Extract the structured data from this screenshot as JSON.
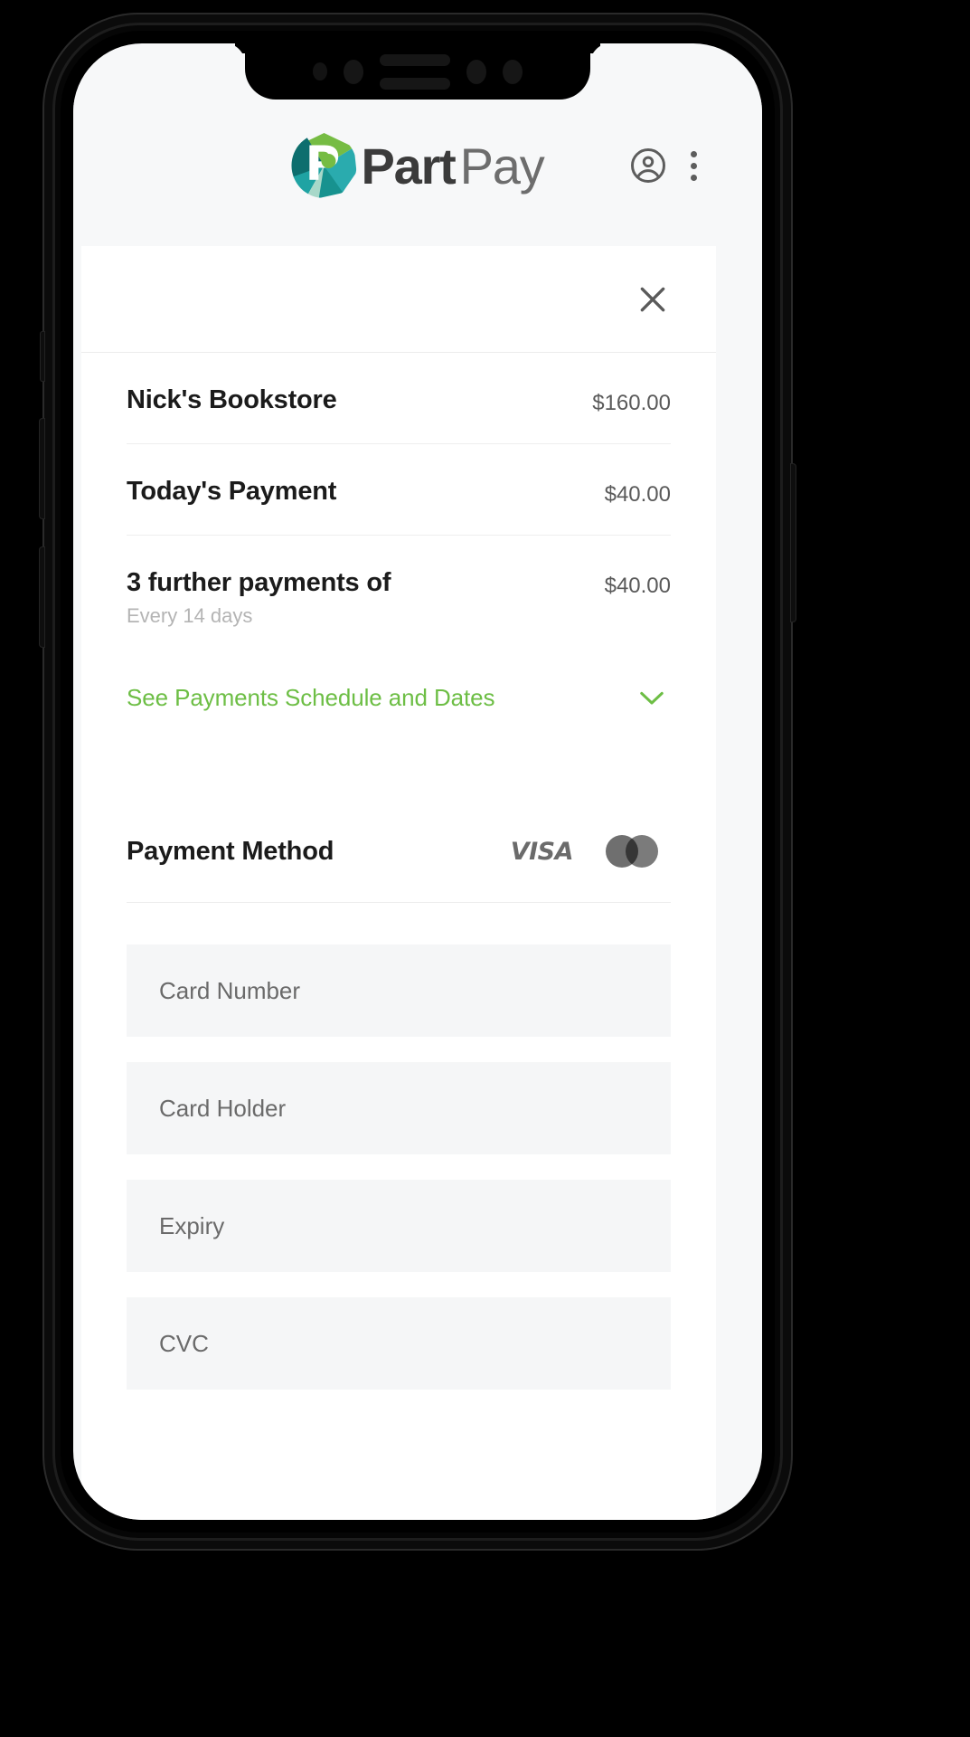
{
  "app": {
    "brand_part": "Part",
    "brand_pay": "Pay",
    "logo_letter": "P"
  },
  "header": {
    "account_icon": "account-circle-icon",
    "overflow_icon": "overflow-menu-icon"
  },
  "checkout": {
    "close_icon": "close-icon",
    "rows": [
      {
        "title": "Nick's Bookstore",
        "subtitle": "",
        "amount": "$160.00"
      },
      {
        "title": "Today's Payment",
        "subtitle": "",
        "amount": "$40.00"
      },
      {
        "title": "3 further payments of",
        "subtitle": "Every 14 days",
        "amount": "$40.00"
      }
    ],
    "schedule_toggle": {
      "label": "See Payments Schedule and Dates",
      "icon": "chevron-down-icon",
      "color": "#6dbe45"
    }
  },
  "payment_method": {
    "title": "Payment Method",
    "brands": [
      {
        "name": "visa-logo",
        "label": "VISA"
      },
      {
        "name": "mastercard-logo",
        "label": ""
      }
    ],
    "fields": [
      {
        "name": "card-number-input",
        "placeholder": "Card Number",
        "value": ""
      },
      {
        "name": "card-holder-input",
        "placeholder": "Card Holder",
        "value": ""
      },
      {
        "name": "expiry-input",
        "placeholder": "Expiry",
        "value": ""
      },
      {
        "name": "cvc-input",
        "placeholder": "CVC",
        "value": ""
      }
    ]
  },
  "colors": {
    "brand_green": "#6dbe45",
    "logo_teal": "#1fa3a3",
    "logo_dark_teal": "#0d6e6e",
    "logo_mint": "#a8d8c9",
    "text_dark": "#1b1b1b",
    "text_muted": "#b4b4b4",
    "field_bg": "#f5f6f7",
    "screen_bg": "#f7f8f9"
  }
}
